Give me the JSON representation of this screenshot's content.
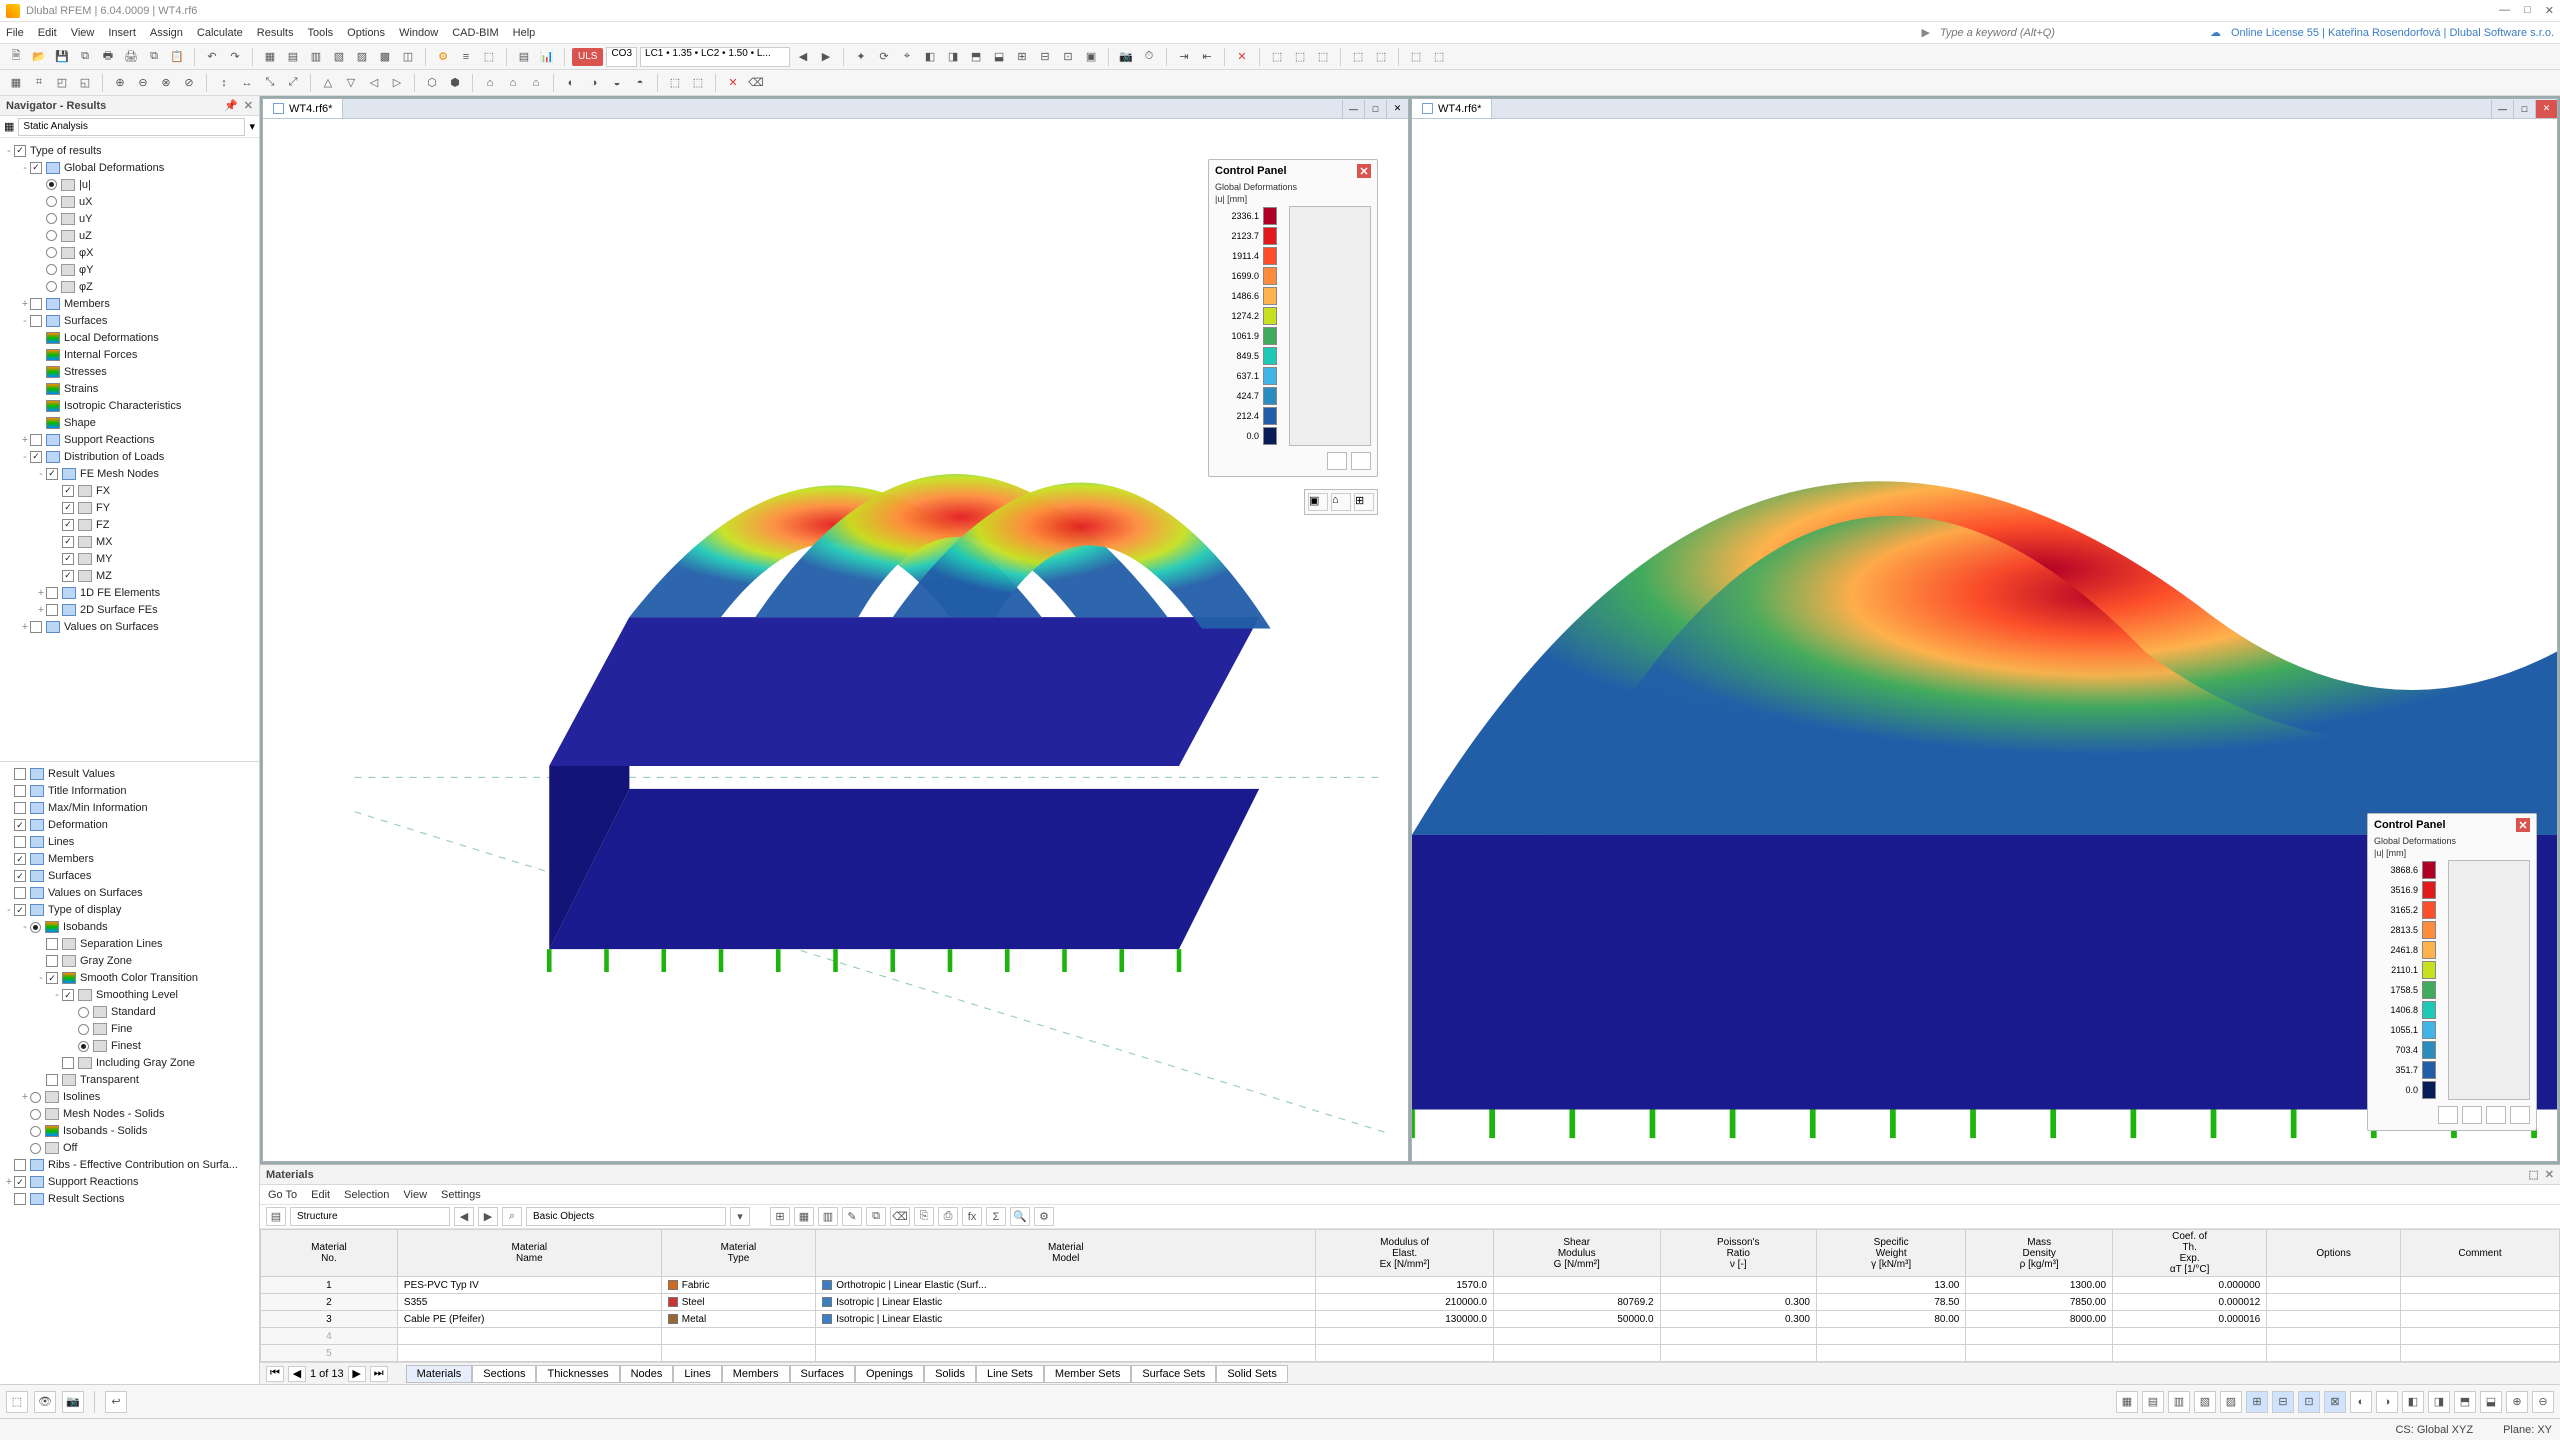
{
  "app_title": "Dlubal RFEM | 6.04.0009 | WT4.rf6",
  "win_buttons": {
    "min": "—",
    "max": "□",
    "close": "✕"
  },
  "menu": [
    "File",
    "Edit",
    "View",
    "Insert",
    "Assign",
    "Calculate",
    "Results",
    "Tools",
    "Options",
    "Window",
    "CAD-BIM",
    "Help"
  ],
  "search_placeholder": "Type a keyword (Alt+Q)",
  "license_line": "Online License 55 | Kateřina Rosendorfová | Dlubal Software s.r.o.",
  "toolbar1": {
    "uls_chip": "ULS",
    "co_chip": "CO3",
    "combo_label": "LC1 • 1.35 • LC2 • 1.50 • L..."
  },
  "navigator": {
    "title": "Navigator - Results",
    "analysis_mode": "Static Analysis",
    "tree1": [
      {
        "d": 0,
        "e": "-",
        "cb": true,
        "lbl": "Type of results"
      },
      {
        "d": 1,
        "e": "-",
        "cb": true,
        "ic": "box",
        "lbl": "Global Deformations"
      },
      {
        "d": 2,
        "rb": true,
        "ic": "sq",
        "lbl": "|u|"
      },
      {
        "d": 2,
        "rb": false,
        "ic": "sq",
        "lbl": "uX"
      },
      {
        "d": 2,
        "rb": false,
        "ic": "sq",
        "lbl": "uY"
      },
      {
        "d": 2,
        "rb": false,
        "ic": "sq",
        "lbl": "uZ"
      },
      {
        "d": 2,
        "rb": false,
        "ic": "sq",
        "lbl": "φX"
      },
      {
        "d": 2,
        "rb": false,
        "ic": "sq",
        "lbl": "φY"
      },
      {
        "d": 2,
        "rb": false,
        "ic": "sq",
        "lbl": "φZ"
      },
      {
        "d": 1,
        "e": "+",
        "cb": false,
        "ic": "box",
        "lbl": "Members"
      },
      {
        "d": 1,
        "e": "-",
        "cb": false,
        "ic": "box",
        "lbl": "Surfaces"
      },
      {
        "d": 2,
        "ic": "boxg",
        "lbl": "Local Deformations"
      },
      {
        "d": 2,
        "ic": "boxg",
        "lbl": "Internal Forces"
      },
      {
        "d": 2,
        "ic": "boxg",
        "lbl": "Stresses"
      },
      {
        "d": 2,
        "ic": "boxg",
        "lbl": "Strains"
      },
      {
        "d": 2,
        "ic": "boxg",
        "lbl": "Isotropic Characteristics"
      },
      {
        "d": 2,
        "ic": "boxg",
        "lbl": "Shape"
      },
      {
        "d": 1,
        "e": "+",
        "cb": false,
        "ic": "box",
        "lbl": "Support Reactions"
      },
      {
        "d": 1,
        "e": "-",
        "cb": true,
        "ic": "box",
        "lbl": "Distribution of Loads"
      },
      {
        "d": 2,
        "e": "-",
        "cb": true,
        "ic": "box",
        "lbl": "FE Mesh Nodes"
      },
      {
        "d": 3,
        "cb": true,
        "ic": "sq",
        "lbl": "FX"
      },
      {
        "d": 3,
        "cb": true,
        "ic": "sq",
        "lbl": "FY"
      },
      {
        "d": 3,
        "cb": true,
        "ic": "sq",
        "lbl": "FZ"
      },
      {
        "d": 3,
        "cb": true,
        "ic": "sq",
        "lbl": "MX"
      },
      {
        "d": 3,
        "cb": true,
        "ic": "sq",
        "lbl": "MY"
      },
      {
        "d": 3,
        "cb": true,
        "ic": "sq",
        "lbl": "MZ"
      },
      {
        "d": 2,
        "e": "+",
        "cb": false,
        "ic": "box",
        "lbl": "1D FE Elements"
      },
      {
        "d": 2,
        "e": "+",
        "cb": false,
        "ic": "box",
        "lbl": "2D Surface FEs"
      },
      {
        "d": 1,
        "e": "+",
        "cb": false,
        "ic": "box",
        "lbl": "Values on Surfaces"
      }
    ],
    "tree2": [
      {
        "d": 0,
        "cb": false,
        "ic": "box",
        "lbl": "Result Values"
      },
      {
        "d": 0,
        "cb": false,
        "ic": "box",
        "lbl": "Title Information"
      },
      {
        "d": 0,
        "cb": false,
        "ic": "box",
        "lbl": "Max/Min Information"
      },
      {
        "d": 0,
        "cb": true,
        "ic": "box",
        "lbl": "Deformation"
      },
      {
        "d": 0,
        "cb": false,
        "ic": "box",
        "lbl": "Lines"
      },
      {
        "d": 0,
        "cb": true,
        "ic": "box",
        "lbl": "Members"
      },
      {
        "d": 0,
        "cb": true,
        "ic": "box",
        "lbl": "Surfaces"
      },
      {
        "d": 0,
        "cb": false,
        "ic": "box",
        "lbl": "Values on Surfaces"
      },
      {
        "d": 0,
        "e": "-",
        "cb": true,
        "ic": "box",
        "lbl": "Type of display"
      },
      {
        "d": 1,
        "e": "-",
        "rb": true,
        "ic": "boxg",
        "lbl": "Isobands"
      },
      {
        "d": 2,
        "cb": false,
        "ic": "sq",
        "lbl": "Separation Lines"
      },
      {
        "d": 2,
        "cb": false,
        "ic": "sq",
        "lbl": "Gray Zone"
      },
      {
        "d": 2,
        "e": "-",
        "cb": true,
        "ic": "boxg",
        "lbl": "Smooth Color Transition"
      },
      {
        "d": 3,
        "e": "-",
        "cb": true,
        "ic": "sq",
        "lbl": "Smoothing Level"
      },
      {
        "d": 4,
        "rb": false,
        "ic": "sq",
        "lbl": "Standard"
      },
      {
        "d": 4,
        "rb": false,
        "ic": "sq",
        "lbl": "Fine"
      },
      {
        "d": 4,
        "rb": true,
        "ic": "sq",
        "lbl": "Finest"
      },
      {
        "d": 3,
        "cb": false,
        "ic": "sq",
        "lbl": "Including Gray Zone"
      },
      {
        "d": 2,
        "cb": false,
        "ic": "sq",
        "lbl": "Transparent"
      },
      {
        "d": 1,
        "e": "+",
        "rb": false,
        "ic": "sq",
        "lbl": "Isolines"
      },
      {
        "d": 1,
        "rb": false,
        "ic": "sq",
        "lbl": "Mesh Nodes - Solids"
      },
      {
        "d": 1,
        "rb": false,
        "ic": "boxg",
        "lbl": "Isobands - Solids"
      },
      {
        "d": 1,
        "rb": false,
        "ic": "sq",
        "lbl": "Off"
      },
      {
        "d": 0,
        "cb": false,
        "ic": "box",
        "lbl": "Ribs - Effective Contribution on Surfa..."
      },
      {
        "d": 0,
        "e": "+",
        "cb": true,
        "ic": "box",
        "lbl": "Support Reactions"
      },
      {
        "d": 0,
        "cb": false,
        "ic": "box",
        "lbl": "Result Sections"
      }
    ]
  },
  "view_tabs": {
    "left": "WT4.rf6*",
    "right": "WT4.rf6*"
  },
  "control_panels": {
    "title": "Control Panel",
    "subtitle": "Global Deformations",
    "unit": "|u| [mm]",
    "left": {
      "values": [
        "2336.1",
        "2123.7",
        "1911.4",
        "1699.0",
        "1486.6",
        "1274.2",
        "1061.9",
        "849.5",
        "637.1",
        "424.7",
        "212.4",
        "0.0"
      ],
      "colors": [
        "#b10026",
        "#e31a1c",
        "#fc4e2a",
        "#fd8d3c",
        "#feb24c",
        "#c7e020",
        "#41ab5d",
        "#1fc9b6",
        "#41b6e6",
        "#2b8cbe",
        "#225ea8",
        "#081d58"
      ]
    },
    "right": {
      "values": [
        "3868.6",
        "3516.9",
        "3165.2",
        "2813.5",
        "2461.8",
        "2110.1",
        "1758.5",
        "1406.8",
        "1055.1",
        "703.4",
        "351.7",
        "0.0"
      ],
      "colors": [
        "#b10026",
        "#e31a1c",
        "#fc4e2a",
        "#fd8d3c",
        "#feb24c",
        "#c7e020",
        "#41ab5d",
        "#1fc9b6",
        "#41b6e6",
        "#2b8cbe",
        "#225ea8",
        "#081d58"
      ]
    }
  },
  "materials": {
    "title": "Materials",
    "menu": [
      "Go To",
      "Edit",
      "Selection",
      "View",
      "Settings"
    ],
    "filter1": "Structure",
    "filter2": "Basic Objects",
    "headers_top": [
      "Material No.",
      "Material Name",
      "Material Type",
      "Material Model",
      "Modulus of Elast. Ex [N/mm²]",
      "Shear Modulus G [N/mm²]",
      "Poisson's Ratio ν [-]",
      "Specific Weight γ [kN/m³]",
      "Mass Density ρ [kg/m³]",
      "Coef. of Th. Exp. αT [1/°C]",
      "Options",
      "Comment"
    ],
    "rows": [
      {
        "no": "1",
        "name": "PES-PVC Typ IV",
        "type": "Fabric",
        "type_color": "#d2691e",
        "model": "Orthotropic | Linear Elastic (Surf...",
        "model_color": "#3a7ec5",
        "E": "1570.0",
        "G": "",
        "nu": "",
        "gamma": "13.00",
        "rho": "1300.00",
        "alpha": "0.000000"
      },
      {
        "no": "2",
        "name": "S355",
        "type": "Steel",
        "type_color": "#cc3333",
        "model": "Isotropic | Linear Elastic",
        "model_color": "#3a7ec5",
        "E": "210000.0",
        "G": "80769.2",
        "nu": "0.300",
        "gamma": "78.50",
        "rho": "7850.00",
        "alpha": "0.000012"
      },
      {
        "no": "3",
        "name": "Cable PE (Pfeifer)",
        "type": "Metal",
        "type_color": "#996633",
        "model": "Isotropic | Linear Elastic",
        "model_color": "#3a7ec5",
        "E": "130000.0",
        "G": "50000.0",
        "nu": "0.300",
        "gamma": "80.00",
        "rho": "8000.00",
        "alpha": "0.000016"
      }
    ],
    "blank_rows": [
      "4",
      "5"
    ],
    "pager": "1 of 13",
    "tabs": [
      "Materials",
      "Sections",
      "Thicknesses",
      "Nodes",
      "Lines",
      "Members",
      "Surfaces",
      "Openings",
      "Solids",
      "Line Sets",
      "Member Sets",
      "Surface Sets",
      "Solid Sets"
    ],
    "active_tab": "Materials"
  },
  "statusbar": {
    "cs": "CS: Global XYZ",
    "plane": "Plane: XY"
  }
}
